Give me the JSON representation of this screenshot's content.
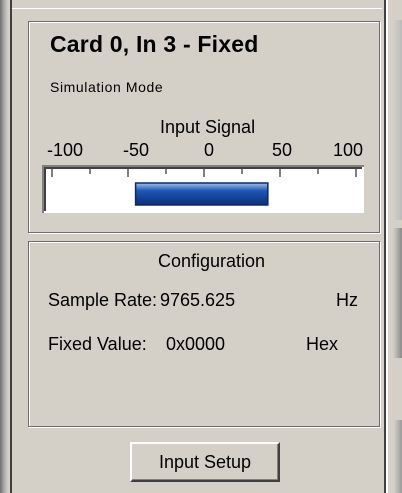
{
  "panel": {
    "title": "Card 0, In 3 - Fixed",
    "mode": "Simulation Mode"
  },
  "meter": {
    "label": "Input Signal",
    "scale_min": -100,
    "scale_max": 100,
    "tick_labels": [
      "-100",
      "-50",
      "0",
      "50",
      "100"
    ],
    "tick_values": [
      -100,
      -50,
      0,
      50,
      100
    ],
    "bar_start": -45,
    "bar_end": 42,
    "bar_color": "#1f56b4"
  },
  "configuration": {
    "title": "Configuration",
    "sample_rate_label": "Sample Rate:",
    "sample_rate_value": "9765.625",
    "sample_rate_unit": "Hz",
    "fixed_value_label": "Fixed Value:",
    "fixed_value_value": "0x0000",
    "fixed_value_unit": "Hex"
  },
  "buttons": {
    "input_setup": "Input Setup"
  }
}
